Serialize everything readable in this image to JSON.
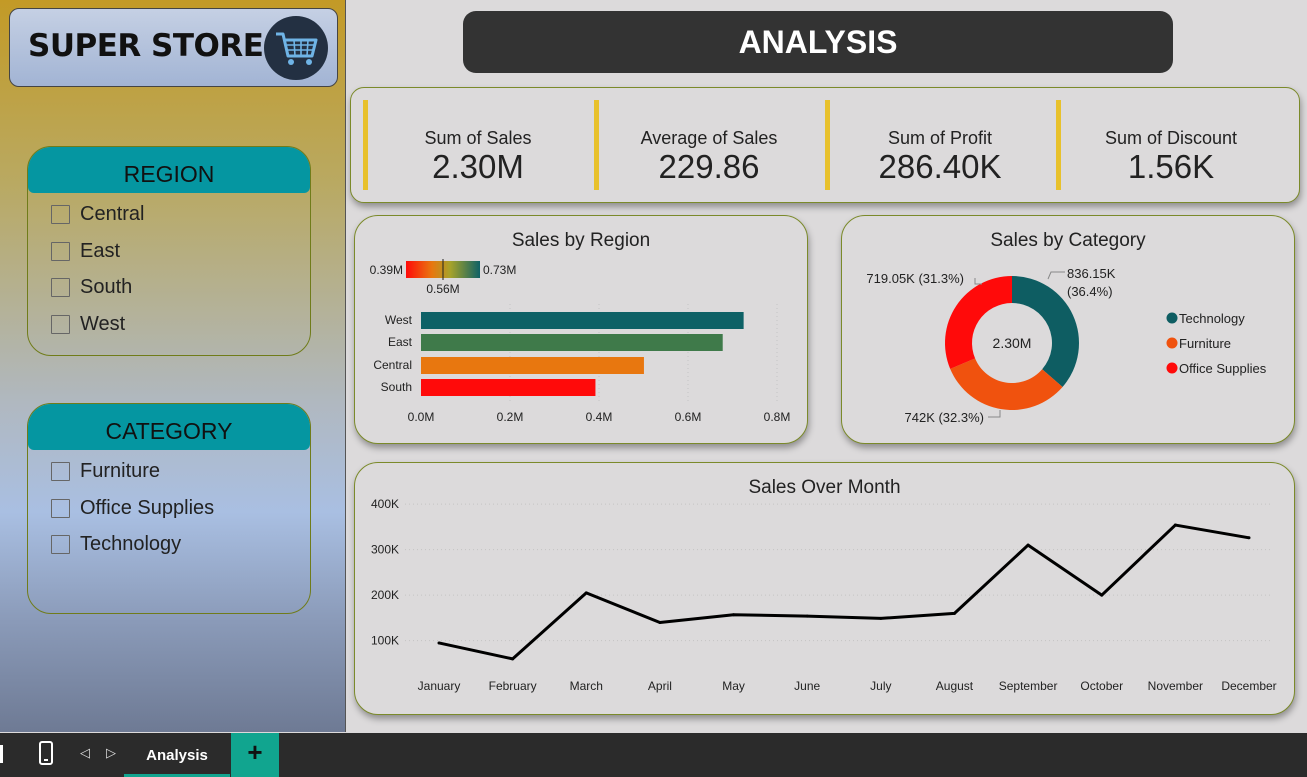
{
  "logo": {
    "text": "SUPER STORE",
    "icon": "shopping-cart-icon"
  },
  "title": "ANALYSIS",
  "slicers": {
    "region": {
      "title": "REGION",
      "items": [
        "Central",
        "East",
        "South",
        "West"
      ]
    },
    "category": {
      "title": "CATEGORY",
      "items": [
        "Furniture",
        "Office Supplies",
        "Technology"
      ]
    }
  },
  "kpis": [
    {
      "label": "Sum of Sales",
      "value": "2.30M"
    },
    {
      "label": "Average of Sales",
      "value": "229.86"
    },
    {
      "label": "Sum of Profit",
      "value": "286.40K"
    },
    {
      "label": "Sum of Discount",
      "value": "1.56K"
    }
  ],
  "chart_data": [
    {
      "type": "bar",
      "orientation": "horizontal",
      "title": "Sales by Region",
      "categories": [
        "West",
        "East",
        "Central",
        "South"
      ],
      "values": [
        0.725,
        0.678,
        0.501,
        0.392
      ],
      "colors": [
        "#0e6166",
        "#3f7a4a",
        "#e8770f",
        "#ff0a0a"
      ],
      "xlim": [
        0,
        0.8
      ],
      "xticks": [
        "0.0M",
        "0.2M",
        "0.4M",
        "0.6M",
        "0.8M"
      ],
      "color_scale": {
        "min": "0.39M",
        "max": "0.73M",
        "mid": "0.56M"
      }
    },
    {
      "type": "pie",
      "variant": "donut",
      "title": "Sales by Category",
      "center_label": "2.30M",
      "slices": [
        {
          "name": "Technology",
          "value": 836.15,
          "label": "836.15K",
          "pct": "(36.4%)",
          "color": "#0e5d62"
        },
        {
          "name": "Furniture",
          "value": 742,
          "label": "742K (32.3%)",
          "pct": "",
          "color": "#f0520e"
        },
        {
          "name": "Office Supplies",
          "value": 719.05,
          "label": "719.05K (31.3%)",
          "pct": "",
          "color": "#ff0a0a"
        }
      ],
      "legend_position": "right"
    },
    {
      "type": "line",
      "title": "Sales Over Month",
      "x": [
        "January",
        "February",
        "March",
        "April",
        "May",
        "June",
        "July",
        "August",
        "September",
        "October",
        "November",
        "December"
      ],
      "values": [
        95,
        60,
        205,
        140,
        157,
        154,
        149,
        160,
        310,
        200,
        354,
        326
      ],
      "unit": "K",
      "ylim": [
        40,
        420
      ],
      "yticks": [
        100,
        200,
        300,
        400
      ],
      "ytick_labels": [
        "100K",
        "200K",
        "300K",
        "400K"
      ],
      "color": "#000000"
    }
  ],
  "footer": {
    "tab": "Analysis",
    "add": "+"
  }
}
